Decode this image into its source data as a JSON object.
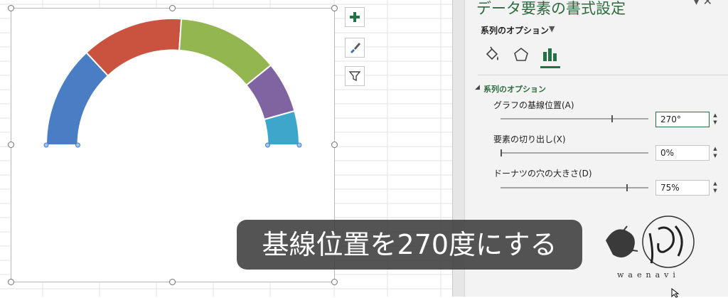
{
  "chart_data": {
    "type": "pie",
    "variant": "doughnut-half",
    "series": [
      {
        "values": [
          30,
          30,
          30,
          15,
          10
        ],
        "colors": [
          "#4a7ec4",
          "#c9533f",
          "#94b650",
          "#8064a2",
          "#3fa6cb"
        ]
      }
    ],
    "hole_size_percent": 75,
    "first_slice_angle_deg": 270
  },
  "side_buttons": {
    "add_element": "chart-elements",
    "style": "chart-styles",
    "filter": "chart-filters"
  },
  "pane": {
    "title": "データ要素の書式設定",
    "subtitle": "系列のオプション",
    "section": "系列のオプション",
    "options": [
      {
        "label": "グラフの基線位置(A)",
        "value": "270°",
        "fill": 0.75
      },
      {
        "label": "要素の切り出し(X)",
        "value": "0%",
        "fill": 0.0
      },
      {
        "label": "ドーナツの穴の大きさ(D)",
        "value": "75%",
        "fill": 0.85
      }
    ]
  },
  "caption": "基線位置を270度にする",
  "logo": {
    "text": "waenavi"
  }
}
